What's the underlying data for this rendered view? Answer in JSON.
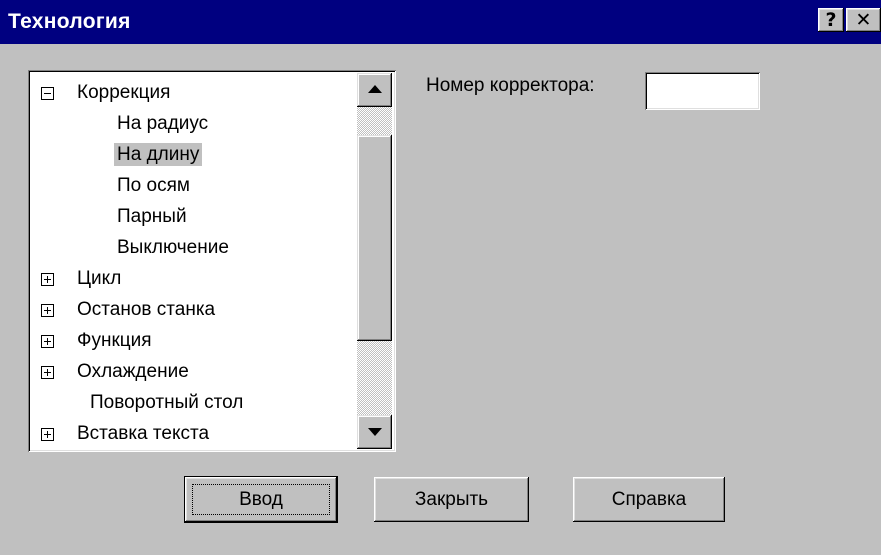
{
  "window": {
    "title": "Технология",
    "help_glyph": "?",
    "close_glyph": "✕"
  },
  "tree": {
    "items": [
      {
        "label": "Коррекция",
        "expander": "minus",
        "selected": false
      },
      {
        "label": "На радиус",
        "expander": "none",
        "selected": false
      },
      {
        "label": "На длину",
        "expander": "none",
        "selected": true
      },
      {
        "label": "По осям",
        "expander": "none",
        "selected": false
      },
      {
        "label": "Парный",
        "expander": "none",
        "selected": false
      },
      {
        "label": "Выключение",
        "expander": "none",
        "selected": false
      },
      {
        "label": "Цикл",
        "expander": "plus",
        "selected": false
      },
      {
        "label": "Останов станка",
        "expander": "plus",
        "selected": false
      },
      {
        "label": "Функция",
        "expander": "plus",
        "selected": false
      },
      {
        "label": "Охлаждение",
        "expander": "plus",
        "selected": false
      },
      {
        "label": "Поворотный стол",
        "expander": "none",
        "selected": false
      },
      {
        "label": "Вставка текста",
        "expander": "plus",
        "selected": false
      }
    ]
  },
  "corrector": {
    "label": "Номер корректора:",
    "value": ""
  },
  "buttons": {
    "enter": "Ввод",
    "close": "Закрыть",
    "help": "Справка"
  },
  "colors": {
    "titlebar": "#000080",
    "face": "#c0c0c0",
    "selection": "#c0c0c0"
  }
}
